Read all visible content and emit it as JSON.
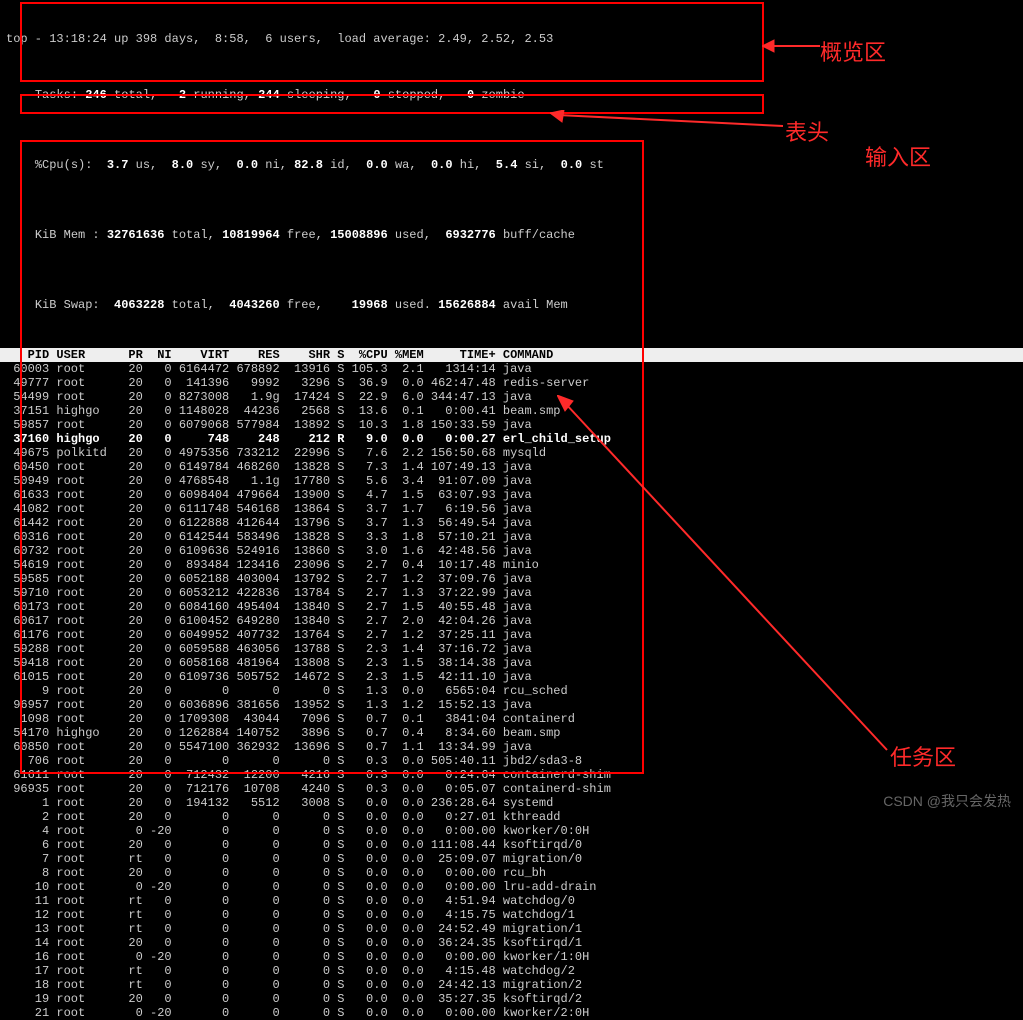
{
  "annotations": {
    "overview": "概览区",
    "header": "表头",
    "input": "输入区",
    "tasks": "任务区"
  },
  "watermark": "CSDN @我只会发热",
  "summary": {
    "line1_a": "top - 13:18:24 up 398 days,  8:58,  6 users,  load average: 2.49, 2.52, 2.53",
    "tasks_pre": "Tasks: ",
    "tasks_total": "246 ",
    "tasks_mid1": "total,   ",
    "tasks_run": "2 ",
    "tasks_mid2": "running, ",
    "tasks_sleep": "244 ",
    "tasks_mid3": "sleeping,   ",
    "tasks_stop": "0 ",
    "tasks_mid4": "stopped,   ",
    "tasks_zomb": "0 ",
    "tasks_end": "zombie",
    "cpu_pre": "%Cpu(s):  ",
    "cpu_us": "3.7 ",
    "cpu_l1": "us,  ",
    "cpu_sy": "8.0 ",
    "cpu_l2": "sy,  ",
    "cpu_ni": "0.0 ",
    "cpu_l3": "ni, ",
    "cpu_id": "82.8 ",
    "cpu_l4": "id,  ",
    "cpu_wa": "0.0 ",
    "cpu_l5": "wa,  ",
    "cpu_hi": "0.0 ",
    "cpu_l6": "hi,  ",
    "cpu_si": "5.4 ",
    "cpu_l7": "si,  ",
    "cpu_st": "0.0 ",
    "cpu_l8": "st",
    "mem_pre": "KiB Mem : ",
    "mem_total": "32761636 ",
    "mem_l1": "total, ",
    "mem_free": "10819964 ",
    "mem_l2": "free, ",
    "mem_used": "15008896 ",
    "mem_l3": "used,  ",
    "mem_buff": "6932776 ",
    "mem_l4": "buff/cache",
    "swap_pre": "KiB Swap:  ",
    "swap_total": "4063228 ",
    "swap_l1": "total,  ",
    "swap_free": "4043260 ",
    "swap_l2": "free,    ",
    "swap_used": "19968 ",
    "swap_l3": "used. ",
    "swap_avail": "15626884 ",
    "swap_l4": "avail Mem"
  },
  "header": "   PID USER      PR  NI    VIRT    RES    SHR S  %CPU %MEM     TIME+ COMMAND",
  "rows": [
    {
      "t": " 60003 root      20   0 6164472 678892  13916 S 105.3  2.1   1314:14 java",
      "b": false
    },
    {
      "t": " 49777 root      20   0  141396   9992   3296 S  36.9  0.0 462:47.48 redis-server",
      "b": false
    },
    {
      "t": " 54499 root      20   0 8273008   1.9g  17424 S  22.9  6.0 344:47.13 java",
      "b": false
    },
    {
      "t": " 37151 highgo    20   0 1148028  44236   2568 S  13.6  0.1   0:00.41 beam.smp",
      "b": false
    },
    {
      "t": " 59857 root      20   0 6079068 577984  13892 S  10.3  1.8 150:33.59 java",
      "b": false
    },
    {
      "t": " 37160 highgo    20   0     748    248    212 R   9.0  0.0   0:00.27 erl_child_setup",
      "b": true
    },
    {
      "t": " 49675 polkitd   20   0 4975356 733212  22996 S   7.6  2.2 156:50.68 mysqld",
      "b": false
    },
    {
      "t": " 60450 root      20   0 6149784 468260  13828 S   7.3  1.4 107:49.13 java",
      "b": false
    },
    {
      "t": " 50949 root      20   0 4768548   1.1g  17780 S   5.6  3.4  91:07.09 java",
      "b": false
    },
    {
      "t": " 61633 root      20   0 6098404 479664  13900 S   4.7  1.5  63:07.93 java",
      "b": false
    },
    {
      "t": " 41082 root      20   0 6111748 546168  13864 S   3.7  1.7   6:19.56 java",
      "b": false
    },
    {
      "t": " 61442 root      20   0 6122888 412644  13796 S   3.7  1.3  56:49.54 java",
      "b": false
    },
    {
      "t": " 60316 root      20   0 6142544 583496  13828 S   3.3  1.8  57:10.21 java",
      "b": false
    },
    {
      "t": " 60732 root      20   0 6109636 524916  13860 S   3.0  1.6  42:48.56 java",
      "b": false
    },
    {
      "t": " 54619 root      20   0  893484 123416  23096 S   2.7  0.4  10:17.48 minio",
      "b": false
    },
    {
      "t": " 59585 root      20   0 6052188 403004  13792 S   2.7  1.2  37:09.76 java",
      "b": false
    },
    {
      "t": " 59710 root      20   0 6053212 422836  13784 S   2.7  1.3  37:22.99 java",
      "b": false
    },
    {
      "t": " 60173 root      20   0 6084160 495404  13840 S   2.7  1.5  40:55.48 java",
      "b": false
    },
    {
      "t": " 60617 root      20   0 6100452 649280  13840 S   2.7  2.0  42:04.26 java",
      "b": false
    },
    {
      "t": " 61176 root      20   0 6049952 407732  13764 S   2.7  1.2  37:25.11 java",
      "b": false
    },
    {
      "t": " 59288 root      20   0 6059588 463056  13788 S   2.3  1.4  37:16.72 java",
      "b": false
    },
    {
      "t": " 59418 root      20   0 6058168 481964  13808 S   2.3  1.5  38:14.38 java",
      "b": false
    },
    {
      "t": " 61015 root      20   0 6109736 505752  14672 S   2.3  1.5  42:11.10 java",
      "b": false
    },
    {
      "t": "     9 root      20   0       0      0      0 S   1.3  0.0   6565:04 rcu_sched",
      "b": false
    },
    {
      "t": " 96957 root      20   0 6036896 381656  13952 S   1.3  1.2  15:52.13 java",
      "b": false
    },
    {
      "t": "  1098 root      20   0 1709308  43044   7096 S   0.7  0.1   3841:04 containerd",
      "b": false
    },
    {
      "t": " 54170 highgo    20   0 1262884 140752   3896 S   0.7  0.4   8:34.60 beam.smp",
      "b": false
    },
    {
      "t": " 60850 root      20   0 5547100 362932  13696 S   0.7  1.1  13:34.99 java",
      "b": false
    },
    {
      "t": "   706 root      20   0       0      0      0 S   0.3  0.0 505:40.11 jbd2/sda3-8",
      "b": false
    },
    {
      "t": " 61611 root      20   0  712432  12200   4216 S   0.3  0.0   0:24.64 containerd-shim",
      "b": false
    },
    {
      "t": " 96935 root      20   0  712176  10708   4240 S   0.3  0.0   0:05.07 containerd-shim",
      "b": false
    },
    {
      "t": "     1 root      20   0  194132   5512   3008 S   0.0  0.0 236:28.64 systemd",
      "b": false
    },
    {
      "t": "     2 root      20   0       0      0      0 S   0.0  0.0   0:27.01 kthreadd",
      "b": false
    },
    {
      "t": "     4 root       0 -20       0      0      0 S   0.0  0.0   0:00.00 kworker/0:0H",
      "b": false
    },
    {
      "t": "     6 root      20   0       0      0      0 S   0.0  0.0 111:08.44 ksoftirqd/0",
      "b": false
    },
    {
      "t": "     7 root      rt   0       0      0      0 S   0.0  0.0  25:09.07 migration/0",
      "b": false
    },
    {
      "t": "     8 root      20   0       0      0      0 S   0.0  0.0   0:00.00 rcu_bh",
      "b": false
    },
    {
      "t": "    10 root       0 -20       0      0      0 S   0.0  0.0   0:00.00 lru-add-drain",
      "b": false
    },
    {
      "t": "    11 root      rt   0       0      0      0 S   0.0  0.0   4:51.94 watchdog/0",
      "b": false
    },
    {
      "t": "    12 root      rt   0       0      0      0 S   0.0  0.0   4:15.75 watchdog/1",
      "b": false
    },
    {
      "t": "    13 root      rt   0       0      0      0 S   0.0  0.0  24:52.49 migration/1",
      "b": false
    },
    {
      "t": "    14 root      20   0       0      0      0 S   0.0  0.0  36:24.35 ksoftirqd/1",
      "b": false
    },
    {
      "t": "    16 root       0 -20       0      0      0 S   0.0  0.0   0:00.00 kworker/1:0H",
      "b": false
    },
    {
      "t": "    17 root      rt   0       0      0      0 S   0.0  0.0   4:15.48 watchdog/2",
      "b": false
    },
    {
      "t": "    18 root      rt   0       0      0      0 S   0.0  0.0  24:42.13 migration/2",
      "b": false
    },
    {
      "t": "    19 root      20   0       0      0      0 S   0.0  0.0  35:27.35 ksoftirqd/2",
      "b": false
    },
    {
      "t": "    21 root       0 -20       0      0      0 S   0.0  0.0   0:00.00 kworker/2:0H",
      "b": false
    }
  ]
}
